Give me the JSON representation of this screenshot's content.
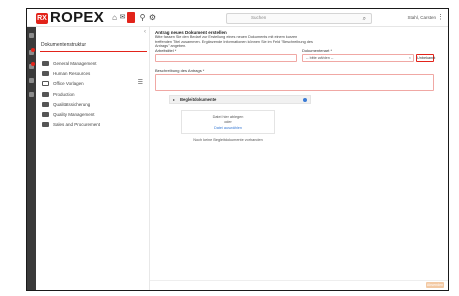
{
  "app": {
    "logo_text": "ROPEX",
    "logo_mark": "RX"
  },
  "topbar": {
    "icons": [
      "home-icon",
      "chat-icon",
      "menu-icon",
      "document-icon",
      "tree-icon",
      "plugin-icon"
    ],
    "search_placeholder": "Suchen",
    "user_name": "Stahl, Carsten",
    "user_menu_icon": "⋮"
  },
  "sidebar": {
    "title": "Dokumentenstruktur",
    "collapse_icon": "‹",
    "items": [
      {
        "label": "General Management",
        "outline": false
      },
      {
        "label": "Human Resources",
        "outline": false
      },
      {
        "label": "Office Vorlagen",
        "outline": true
      },
      {
        "label": "Production",
        "outline": false
      },
      {
        "label": "Qualitätssicherung",
        "outline": false
      },
      {
        "label": "Quality Management",
        "outline": false
      },
      {
        "label": "Sales and Procurement",
        "outline": false
      }
    ]
  },
  "form": {
    "title": "Antrag neues Dokument erstellen",
    "description": "Bitte fassen Sie den Bedarf zur Erstellung eines neuen Dokuments mit einem kurzen treffenden Titel zusammen. Ergänzende Informationen können Sie im Feld \"Beschreibung des Antrags\" angeben.",
    "field_title_label": "Arbeitstitel *",
    "field_type_label": "Dokumentenart *",
    "type_value": "-- bitte wählen --",
    "type_clear": "×",
    "type_button": "Unbekannt",
    "field_desc_label": "Beschreibung des Antrags *",
    "attachments": {
      "title": "Begleitdokumente",
      "caret": "▸",
      "drop_line1": "Datei hier ablegen",
      "drop_line2": "oder",
      "drop_link": "Datei auswählen",
      "empty_text": "Noch keine Begleitdokumente vorhanden"
    },
    "submit_label": "Absenden"
  },
  "colors": {
    "accent": "#e2231a",
    "rail": "#3a3a3a",
    "link": "#3a7bd5"
  }
}
